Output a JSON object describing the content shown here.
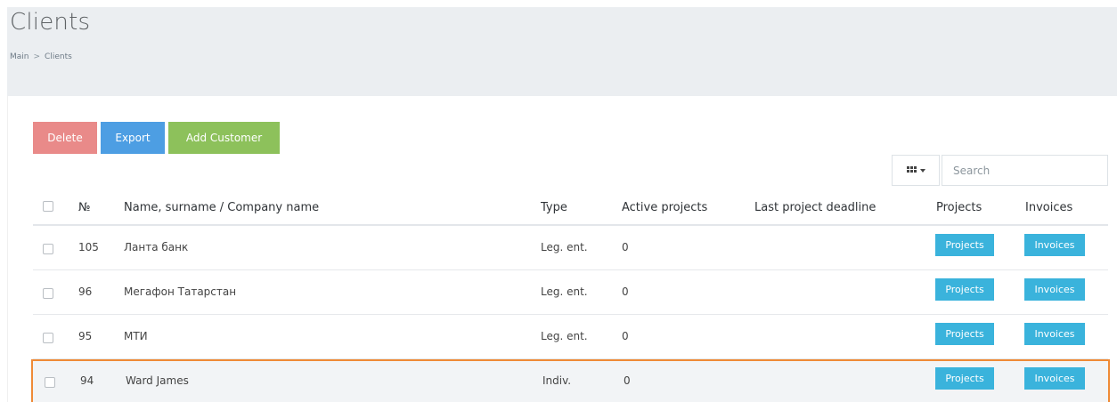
{
  "page": {
    "title": "Clients",
    "breadcrumb": [
      "Main",
      "Clients"
    ],
    "breadcrumb_separator": ">"
  },
  "toolbar": {
    "delete_label": "Delete",
    "export_label": "Export",
    "add_label": "Add Customer",
    "columns_icon": "grid-icon",
    "search_placeholder": "Search"
  },
  "colors": {
    "delete": "#e98a89",
    "export": "#4d9ee3",
    "add": "#8dc15b",
    "action": "#3ab3dc",
    "highlight_border": "#ef8a36"
  },
  "table": {
    "headers": {
      "num": "№",
      "name": "Name, surname / Company name",
      "type": "Type",
      "active": "Active projects",
      "deadline": "Last project deadline",
      "projects": "Projects",
      "invoices": "Invoices"
    },
    "rows": [
      {
        "num": "105",
        "name": "Ланта банк",
        "type": "Leg. ent.",
        "active": "0",
        "deadline": "",
        "projects_label": "Projects",
        "invoices_label": "Invoices"
      },
      {
        "num": "96",
        "name": "Мегафон Татарстан",
        "type": "Leg. ent.",
        "active": "0",
        "deadline": "",
        "projects_label": "Projects",
        "invoices_label": "Invoices"
      },
      {
        "num": "95",
        "name": "МТИ",
        "type": "Leg. ent.",
        "active": "0",
        "deadline": "",
        "projects_label": "Projects",
        "invoices_label": "Invoices"
      },
      {
        "num": "94",
        "name": "Ward James",
        "type": "Indiv.",
        "active": "0",
        "deadline": "",
        "projects_label": "Projects",
        "invoices_label": "Invoices"
      }
    ]
  }
}
